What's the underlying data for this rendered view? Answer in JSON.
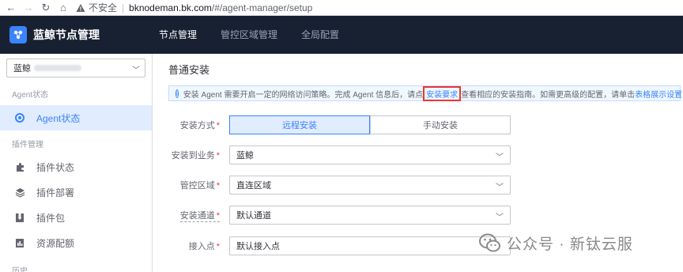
{
  "browser": {
    "back": "←",
    "forward": "→",
    "reload": "↻",
    "home": "⌂",
    "insecure_label": "不安全",
    "url_host": "bknodeman.bk.com",
    "url_path": "/#/agent-manager/setup"
  },
  "header": {
    "app_title": "蓝鲸节点管理",
    "nav": [
      "节点管理",
      "管控区域管理",
      "全局配置"
    ]
  },
  "sidebar": {
    "business_select": "蓝鲸",
    "groups": [
      {
        "title": "Agent状态",
        "items": [
          {
            "label": "Agent状态",
            "icon": "radio-dot-icon"
          }
        ]
      },
      {
        "title": "插件管理",
        "items": [
          {
            "label": "插件状态",
            "icon": "puzzle-icon"
          },
          {
            "label": "插件部署",
            "icon": "layers-icon"
          },
          {
            "label": "插件包",
            "icon": "package-icon"
          },
          {
            "label": "资源配额",
            "icon": "quota-icon"
          }
        ]
      },
      {
        "title": "历史",
        "items": []
      }
    ]
  },
  "main": {
    "title": "普通安装",
    "info": {
      "text_before": "安装 Agent 需要开启一定的网络访问策略。完成 Agent 信息后，请点",
      "link_requirements": "安装要求",
      "text_mid": "查看相应的安装指南。如需更高级的配置，请单击",
      "link_table": "表格展示设置"
    },
    "form": {
      "install_method": {
        "label": "安装方式",
        "options": [
          "远程安装",
          "手动安装"
        ],
        "selected": "远程安装"
      },
      "business": {
        "label": "安装到业务",
        "value": "蓝鲸"
      },
      "control_area": {
        "label": "管控区域",
        "value": "直连区域"
      },
      "channel": {
        "label": "安装通道",
        "value": "默认通道"
      },
      "access_point": {
        "label": "接入点",
        "value": "默认接入点"
      }
    }
  },
  "watermark": "公众号 · 新钛云服",
  "colors": {
    "primary": "#3a84ff",
    "header_bg": "#182132",
    "highlight": "#ea3636"
  }
}
